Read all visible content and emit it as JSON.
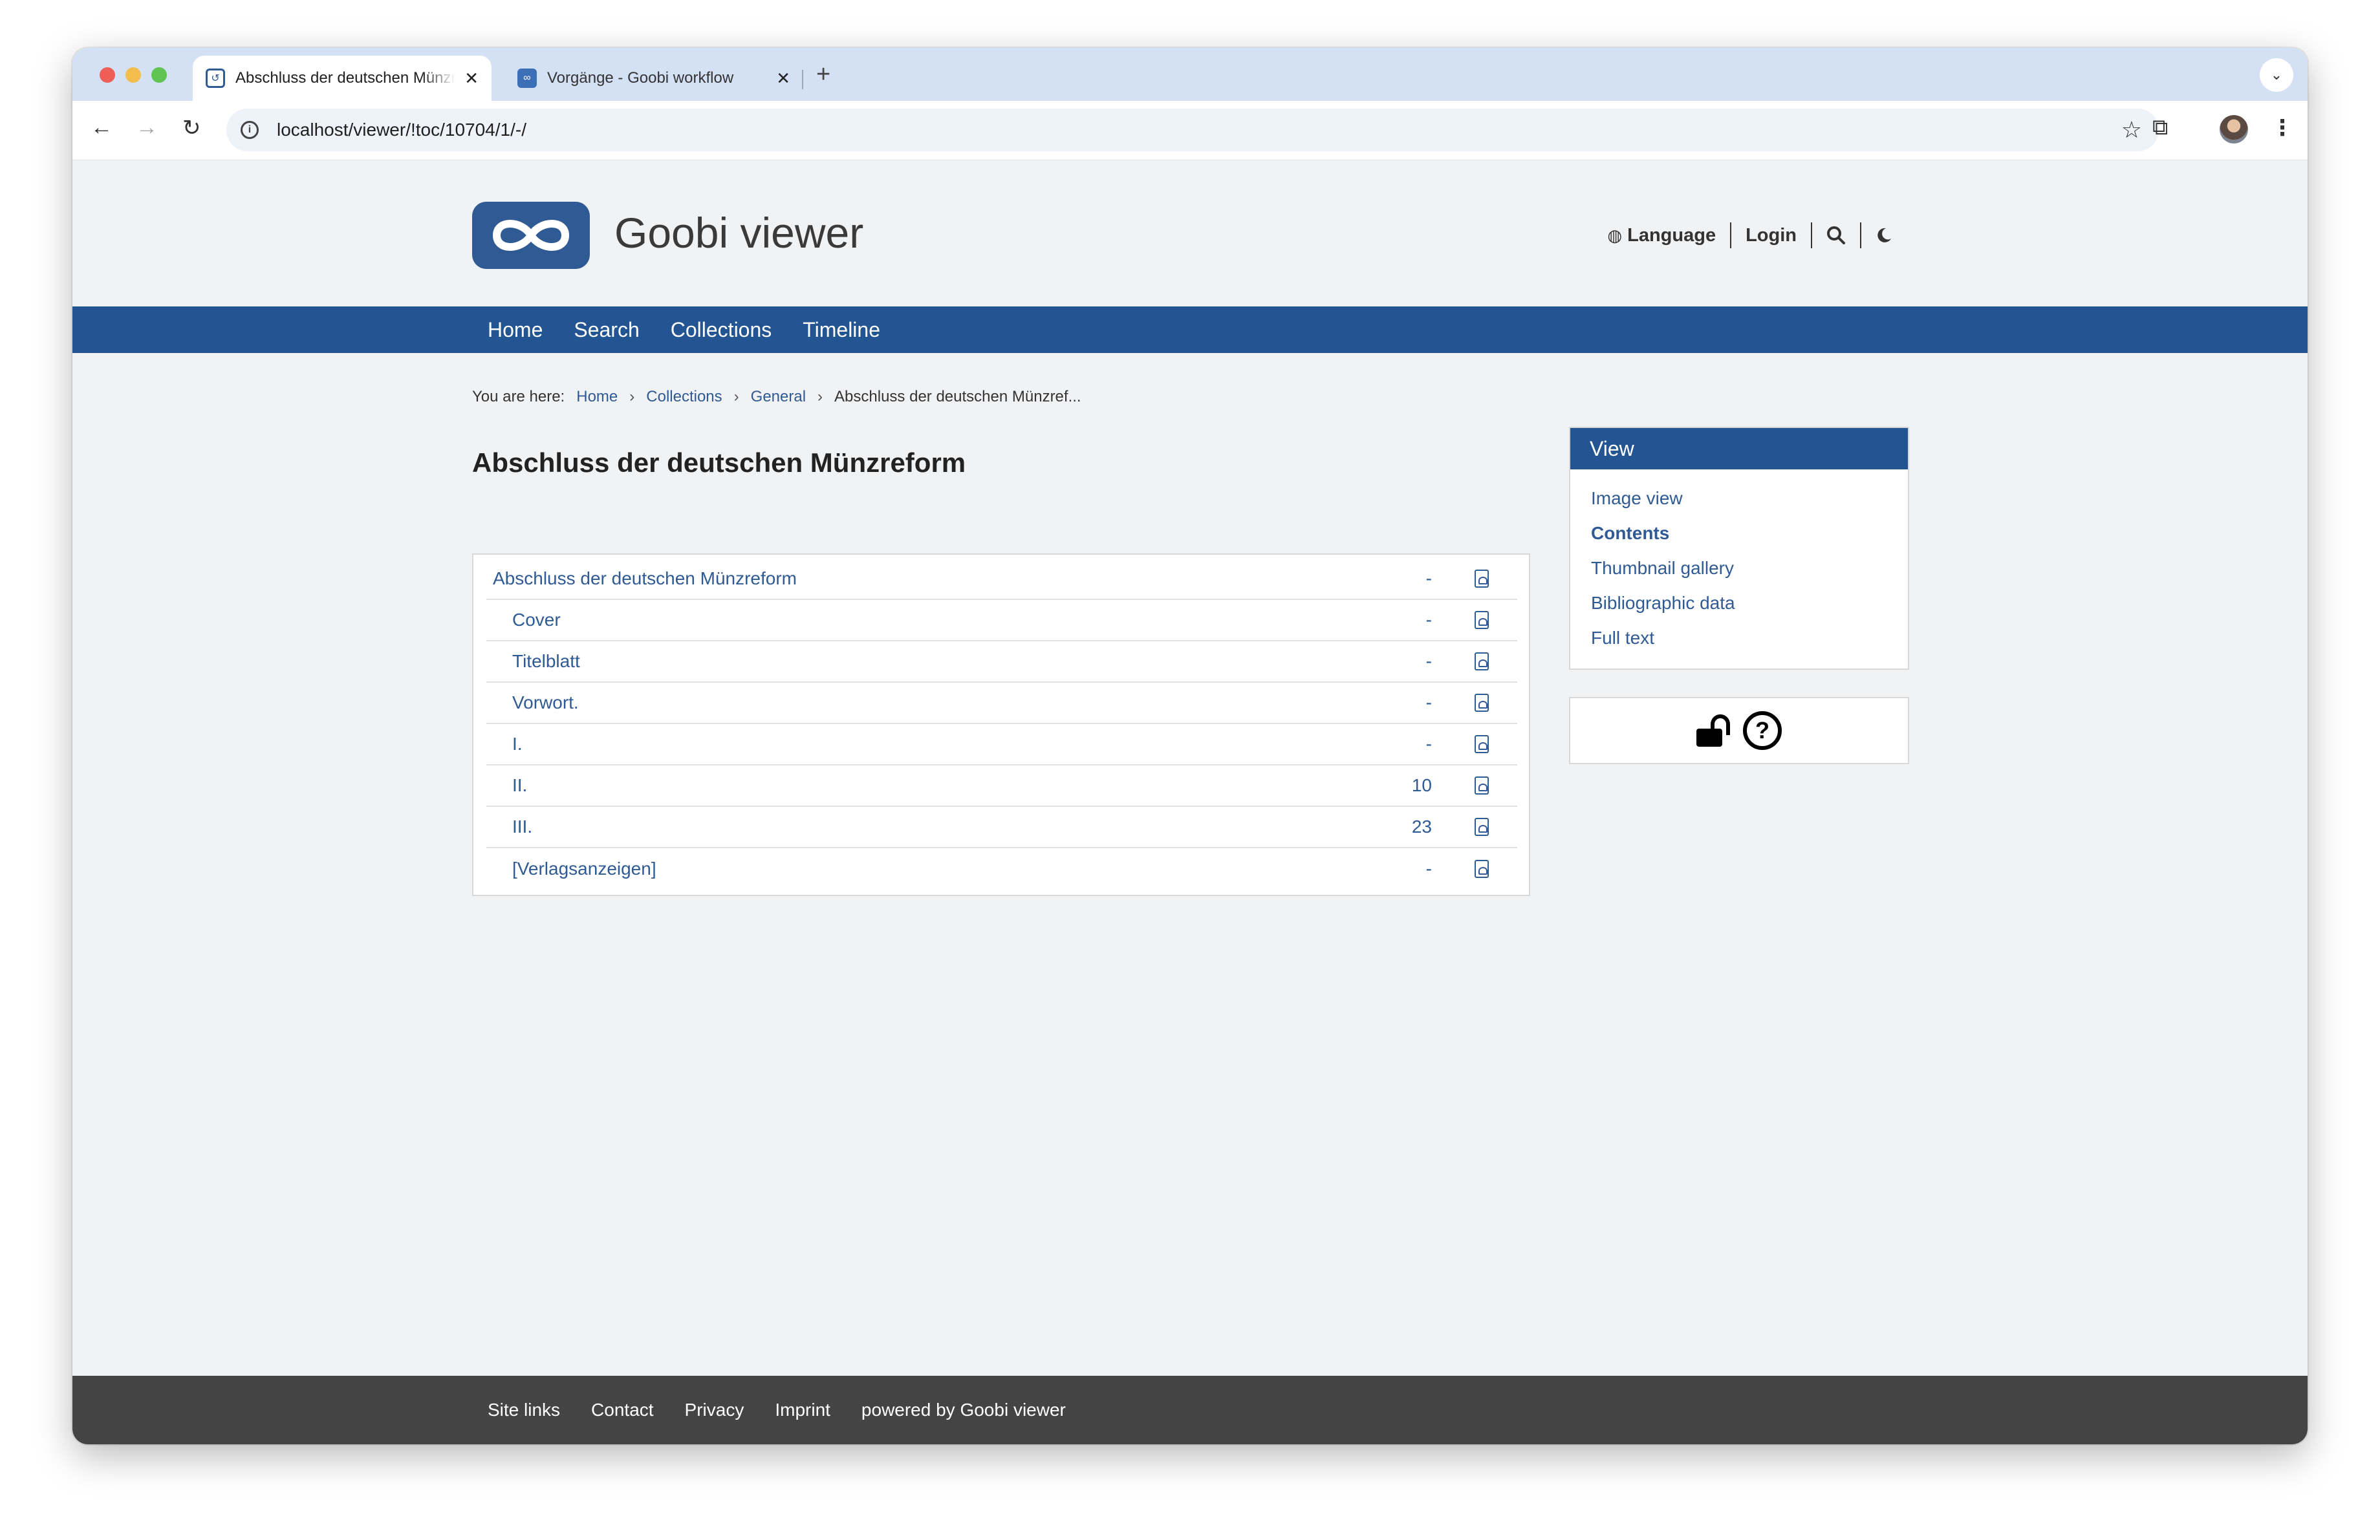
{
  "browser": {
    "tabs": [
      {
        "title": "Abschluss der deutschen Münzreform",
        "active": true
      },
      {
        "title": "Vorgänge - Goobi workflow",
        "active": false
      }
    ],
    "new_tab": "+",
    "close_glyph": "✕",
    "url": "localhost/viewer/!toc/10704/1/-/"
  },
  "site": {
    "title": "Goobi viewer",
    "actions": {
      "language": "Language",
      "login": "Login"
    }
  },
  "nav": [
    "Home",
    "Search",
    "Collections",
    "Timeline"
  ],
  "breadcrumb": {
    "label": "You are here:",
    "items": [
      "Home",
      "Collections",
      "General"
    ],
    "current": "Abschluss der deutschen Münzref..."
  },
  "heading": "Abschluss der deutschen Münzreform",
  "toc": [
    {
      "title": "Abschluss der deutschen Münzreform",
      "page": "-",
      "level": 0
    },
    {
      "title": "Cover",
      "page": "-",
      "level": 1
    },
    {
      "title": "Titelblatt",
      "page": "-",
      "level": 1
    },
    {
      "title": "Vorwort.",
      "page": "-",
      "level": 1
    },
    {
      "title": "I.",
      "page": "-",
      "level": 1
    },
    {
      "title": "II.",
      "page": "10",
      "level": 1
    },
    {
      "title": "III.",
      "page": "23",
      "level": 1
    },
    {
      "title": "[Verlagsanzeigen]",
      "page": "-",
      "level": 1
    }
  ],
  "sidebar": {
    "view_title": "View",
    "view_items": [
      "Image view",
      "Contents",
      "Thumbnail gallery",
      "Bibliographic data",
      "Full text"
    ],
    "current_item": "Contents"
  },
  "footer": [
    "Site links",
    "Contact",
    "Privacy",
    "Imprint",
    "powered by Goobi viewer"
  ],
  "colors": {
    "primary": "#235592",
    "link": "#2f5a94",
    "footer": "#444444",
    "background": "#f1f2f4"
  }
}
